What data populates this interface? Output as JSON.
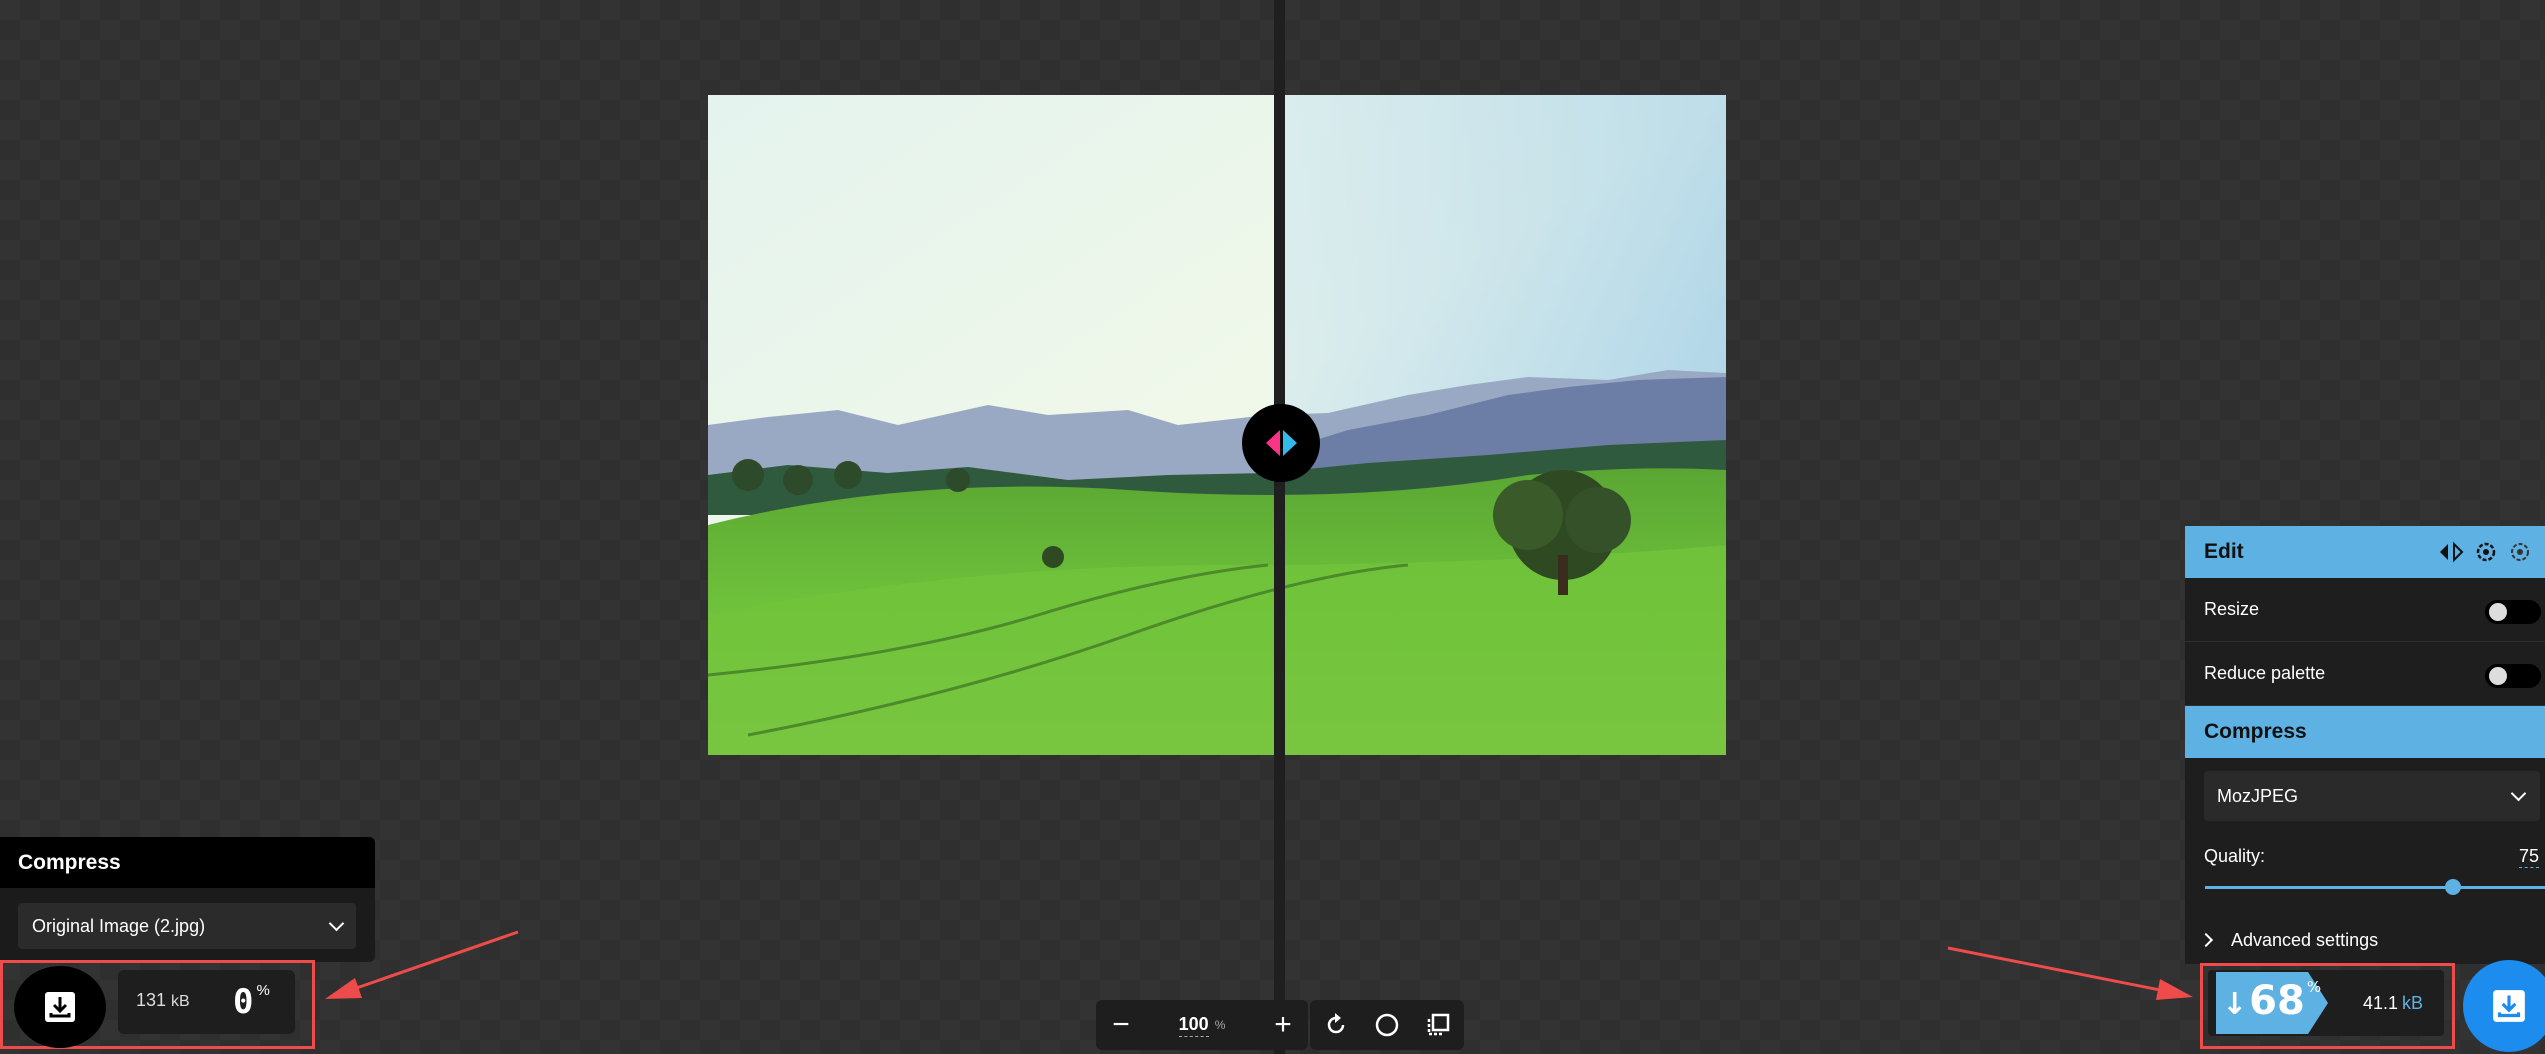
{
  "left": {
    "heading": "Compress",
    "select_value": "Original Image (2.jpg)",
    "size_value": "131",
    "size_unit": "kB",
    "percent": "0",
    "percent_sign": "%"
  },
  "toolbar": {
    "zoom_value": "100",
    "zoom_unit": "%",
    "zoom_out": "−",
    "zoom_in": "+"
  },
  "right": {
    "edit_heading": "Edit",
    "resize_label": "Resize",
    "reduce_palette_label": "Reduce palette",
    "compress_heading": "Compress",
    "codec_value": "MozJPEG",
    "quality_label": "Quality:",
    "quality_value": "75",
    "quality_fraction": 0.75,
    "advanced_label": "Advanced settings",
    "reduction_arrow": "↓",
    "reduction_value": "68",
    "reduction_sign": "%",
    "size_value": "41.1",
    "size_unit": "kB"
  },
  "colors": {
    "accent": "#5eb1e3",
    "download_blue": "#1c8cef",
    "highlight_red": "#ee4b4b",
    "handle_pink": "#ff3385",
    "handle_blue": "#34b9eb"
  }
}
